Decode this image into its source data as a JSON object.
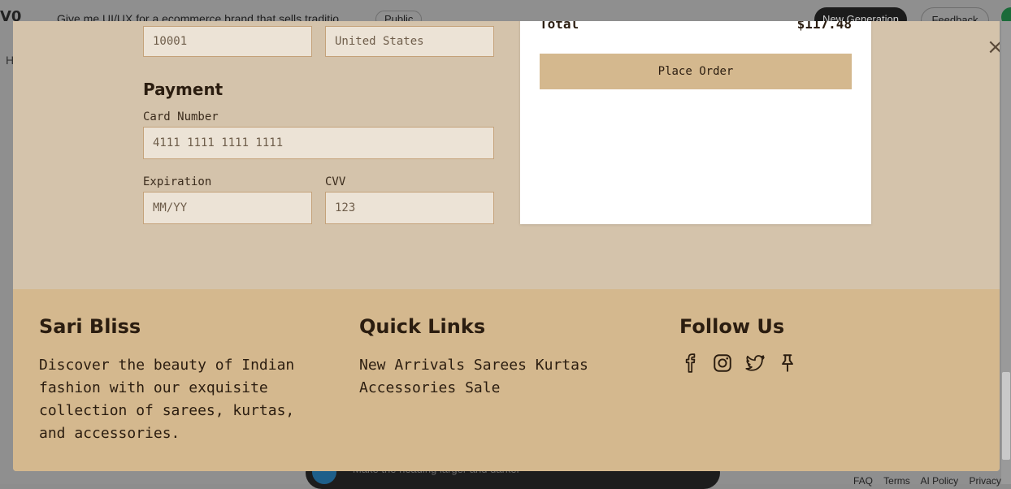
{
  "background": {
    "app_title": "Give me UI/UX for a ecommerce brand that sells traditio",
    "public_label": "Public",
    "new_generation_label": "New Generation",
    "feedback_label": "Feedback",
    "side_letter": "H",
    "prompt_placeholder": "Make the heading larger and darker",
    "footer_links": [
      "FAQ",
      "Terms",
      "AI Policy",
      "Privacy"
    ]
  },
  "modal": {
    "close_label": "×",
    "shipping": {
      "zip_value": "10001",
      "country_value": "United States"
    },
    "payment": {
      "title": "Payment",
      "card_number_label": "Card Number",
      "card_number_placeholder": "4111 1111 1111 1111",
      "expiration_label": "Expiration",
      "expiration_placeholder": "MM/YY",
      "cvv_label": "CVV",
      "cvv_placeholder": "123"
    },
    "summary": {
      "total_label": "Total",
      "total_value": "$117.48",
      "place_order_label": "Place Order"
    },
    "footer": {
      "brand_title": "Sari Bliss",
      "brand_description": "Discover the beauty of Indian fashion with our exquisite collection of sarees, kurtas, and accessories.",
      "quick_links_title": "Quick Links",
      "quick_links": [
        "New Arrivals",
        "Sarees",
        "Kurtas",
        "Accessories",
        "Sale"
      ],
      "follow_title": "Follow Us",
      "social_icons": [
        "facebook-icon",
        "instagram-icon",
        "twitter-icon",
        "pinterest-icon"
      ]
    }
  },
  "colors": {
    "modal_bg": "#d4c3ab",
    "footer_bg": "#d4b88e",
    "input_bg": "#ece3d6",
    "input_border": "#c4a27a",
    "text_dark": "#2b1d10"
  }
}
